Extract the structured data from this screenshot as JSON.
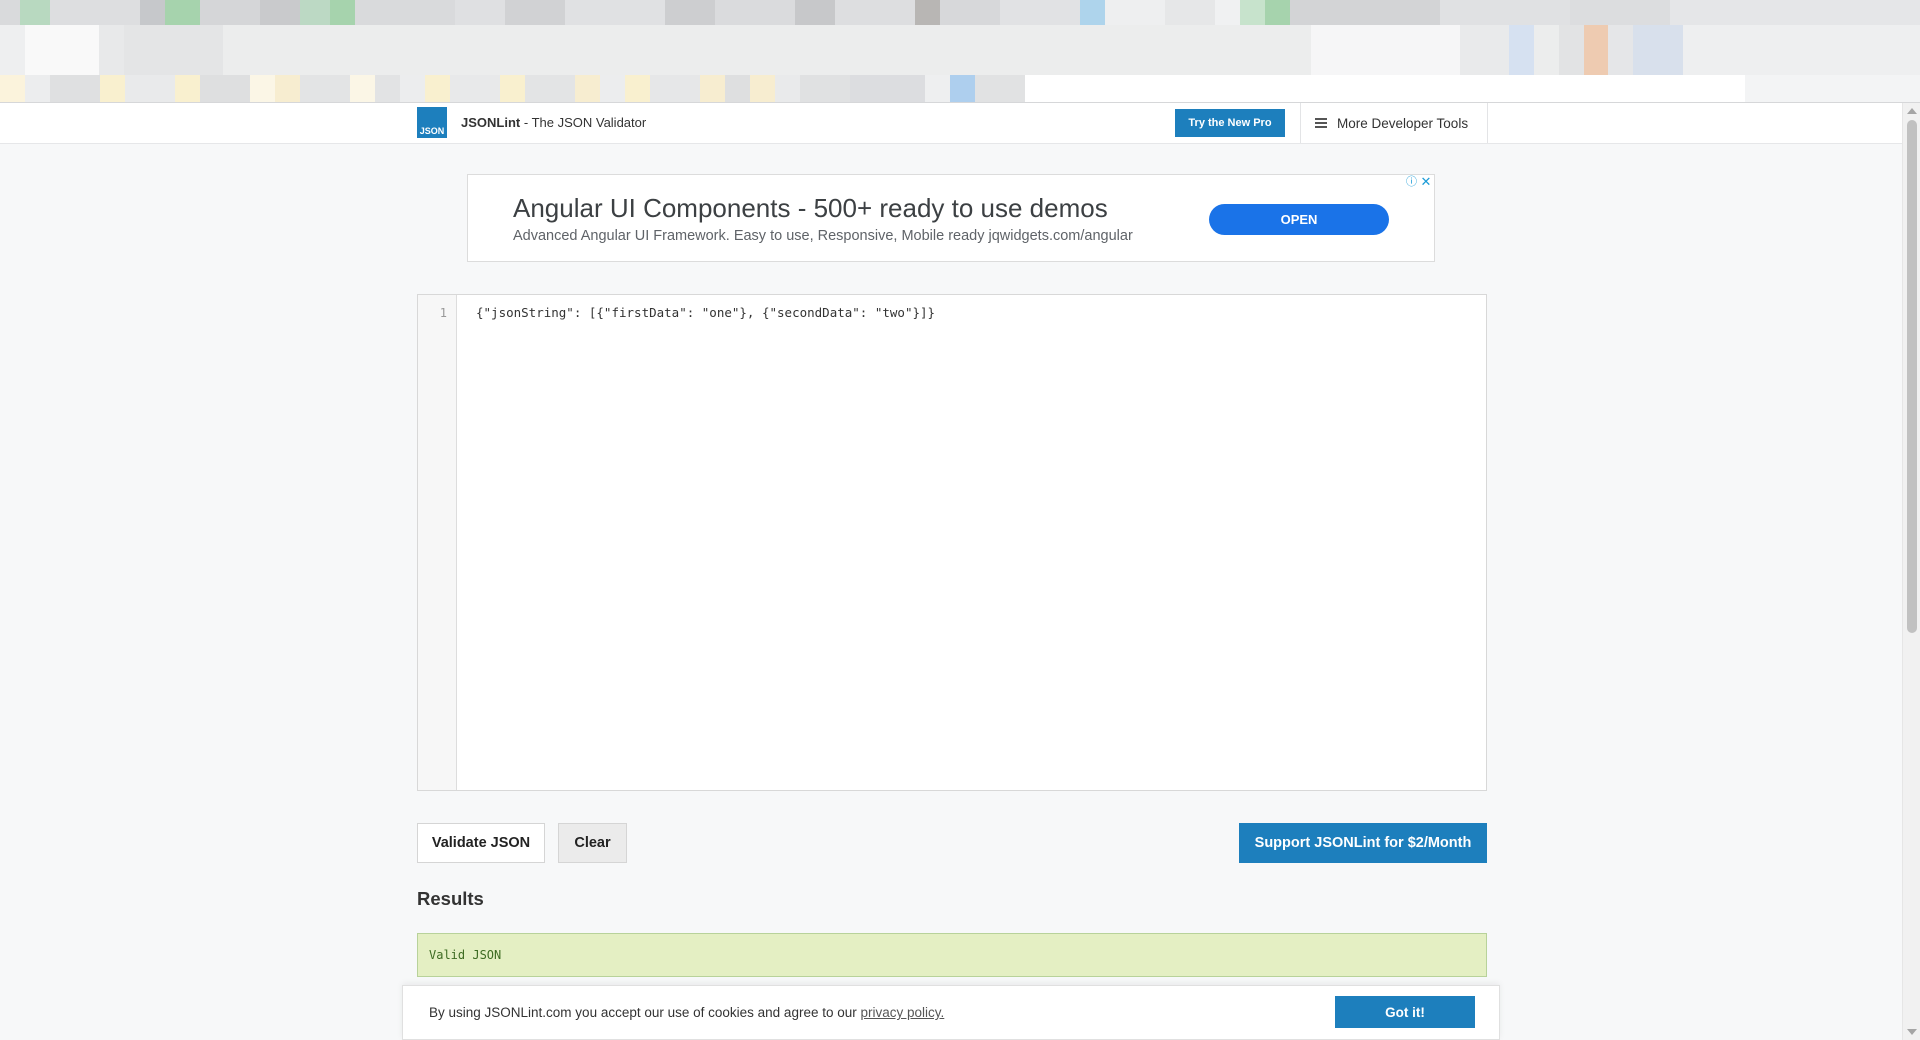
{
  "header": {
    "logo_text": "JSON",
    "brand_name": "JSONLint",
    "brand_sep": " - ",
    "brand_tagline": "The JSON Validator",
    "try_pro_label": "Try the New Pro",
    "more_tools_label": "More Developer Tools",
    "menu_icon": "hamburger-icon"
  },
  "ad": {
    "title": "Angular UI Components - 500+ ready to use demos",
    "description": "Advanced Angular UI Framework. Easy to use, Responsive, Mobile ready jqwidgets.com/angular",
    "open_label": "OPEN",
    "info_glyph": "ⓘ",
    "close_glyph": "✕"
  },
  "editor": {
    "line_number": "1",
    "code": "{\"jsonString\": [{\"firstData\": \"one\"}, {\"secondData\": \"two\"}]}"
  },
  "actions": {
    "validate_label": "Validate JSON",
    "clear_label": "Clear",
    "support_label": "Support JSONLint for $2/Month"
  },
  "results": {
    "heading": "Results",
    "message": "Valid JSON"
  },
  "cookie": {
    "text": "By using JSONLint.com you accept our use of cookies and agree to our ",
    "link_text": "privacy policy.",
    "button_label": "Got it!"
  },
  "colors": {
    "brand_blue": "#1d7fbd",
    "ad_button_blue": "#1a73e8",
    "valid_bg": "#e4efc3",
    "valid_text": "#3d6b22"
  }
}
